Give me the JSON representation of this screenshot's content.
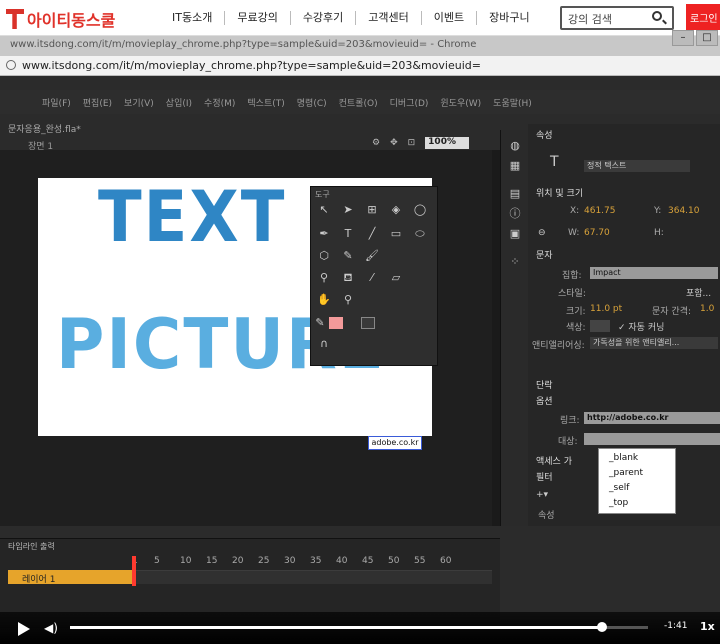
{
  "site": {
    "logo": "아이티동스쿨",
    "nav": [
      "IT동소개",
      "무료강의",
      "수강후기",
      "고객센터",
      "이벤트",
      "장바구니"
    ],
    "search_placeholder": "강의 검색",
    "login": "로그인"
  },
  "browser": {
    "title": "www.itsdong.com/it/m/movieplay_chrome.php?type=sample&uid=203&movieuid= - Chrome",
    "url": "www.itsdong.com/it/m/movieplay_chrome.php?type=sample&uid=203&movieuid="
  },
  "app": {
    "menus": [
      "파일(F)",
      "편집(E)",
      "보기(V)",
      "삽입(I)",
      "수정(M)",
      "텍스트(T)",
      "명령(C)",
      "컨트롤(O)",
      "디버그(D)",
      "윈도우(W)",
      "도움말(H)"
    ],
    "doc_tab": "문자응용_완성.fla*",
    "scene": "장면 1",
    "zoom": "100%",
    "stage_text1": "TEXT",
    "stage_text2": "PICTURE",
    "stage_link_box": "adobe.co.kr",
    "tools_title": "도구",
    "props": {
      "tab": "속성",
      "text_type": "정적 텍스트",
      "sec_pos": "위치 및 크기",
      "x_label": "X:",
      "x_val": "461.75",
      "y_label": "Y:",
      "y_val": "364.10",
      "w_label": "W:",
      "w_val": "67.70",
      "h_label": "H:",
      "sec_char": "문자",
      "family_label": "집합:",
      "family_val": "Impact",
      "style_label": "스타일:",
      "embed_btn": "포함...",
      "size_label": "크기:",
      "size_val": "11.0 pt",
      "spacing_label": "문자 간격:",
      "spacing_val": "1.0",
      "color_label": "색상:",
      "kerning": "✓ 자동 커닝",
      "antialias_label": "앤티앨리어싱:",
      "antialias_val": "가독성을 위한 앤티앨리...",
      "sec_para": "단락",
      "sec_opt": "옵션",
      "link_label": "링크:",
      "link_val": "http://adobe.co.kr",
      "target_label": "대상:",
      "sec_access": "액세스 가",
      "sec_filter": "필터",
      "filter_header": "속성",
      "target_options": [
        "_blank",
        "_parent",
        "_self",
        "_top"
      ]
    },
    "timeline": {
      "tabs": "타임라인   출력",
      "layer": "레이어 1",
      "frames": [
        "1",
        "5",
        "10",
        "15",
        "20",
        "25",
        "30",
        "35",
        "40",
        "45",
        "50",
        "55",
        "60"
      ]
    }
  },
  "video": {
    "time": "-1:41",
    "speed": "1x",
    "progress": 0.92
  }
}
